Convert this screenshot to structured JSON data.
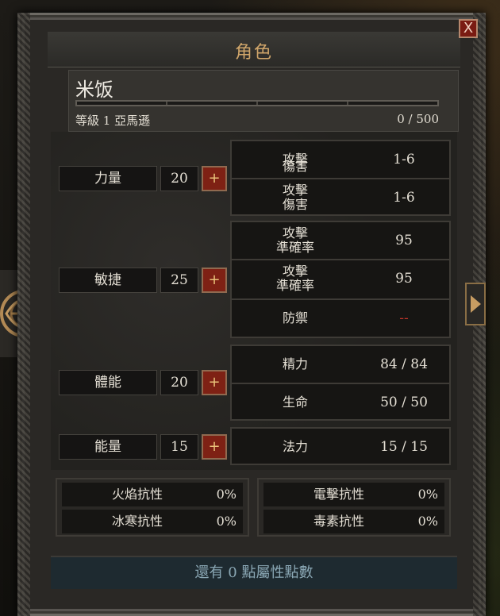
{
  "window": {
    "title": "角色",
    "close_label": "X"
  },
  "character": {
    "name": "米饭",
    "level_line": "等級 1 亞馬遜",
    "xp_text": "0 / 500",
    "xp_progress": 0
  },
  "attributes": [
    {
      "label": "力量",
      "value": "20",
      "plus": "+"
    },
    {
      "label": "敏捷",
      "value": "25",
      "plus": "+"
    },
    {
      "label": "體能",
      "value": "20",
      "plus": "+"
    },
    {
      "label": "能量",
      "value": "15",
      "plus": "+"
    }
  ],
  "derived": {
    "attack_damage_1": {
      "label_line1": "攻擊",
      "label_line2": "傷害",
      "value": "1-6"
    },
    "attack_damage_2": {
      "label_line1": "攻擊",
      "label_line2": "傷害",
      "value": "1-6"
    },
    "attack_rating_1": {
      "label_line1": "攻擊",
      "label_line2": "準確率",
      "value": "95"
    },
    "attack_rating_2": {
      "label_line1": "攻擊",
      "label_line2": "準確率",
      "value": "95"
    },
    "defense": {
      "label": "防禦",
      "value": "--"
    },
    "stamina": {
      "label": "精力",
      "value": "84 / 84"
    },
    "life": {
      "label": "生命",
      "value": "50 / 50"
    },
    "mana": {
      "label": "法力",
      "value": "15 / 15"
    }
  },
  "resistances": [
    {
      "label": "火焰抗性",
      "value": "0%"
    },
    {
      "label": "冰寒抗性",
      "value": "0%"
    },
    {
      "label": "電擊抗性",
      "value": "0%"
    },
    {
      "label": "毒素抗性",
      "value": "0%"
    }
  ],
  "footer": {
    "points_text": "還有 0 點屬性點數"
  },
  "colors": {
    "title_gold": "#cfa56a",
    "defense_value_red": "#c0362a",
    "footer_text": "#8aa7b4",
    "plus_button_red": "#7e2114"
  }
}
